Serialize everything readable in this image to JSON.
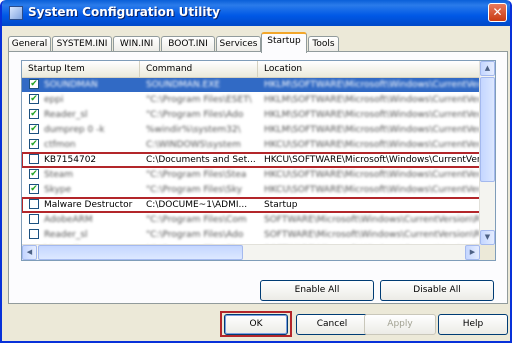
{
  "window": {
    "title": "System Configuration Utility",
    "close_glyph": "✕"
  },
  "tabs": [
    "General",
    "SYSTEM.INI",
    "WIN.INI",
    "BOOT.INI",
    "Services",
    "Startup",
    "Tools"
  ],
  "active_tab": "Startup",
  "columns": [
    "Startup Item",
    "Command",
    "Location"
  ],
  "rows": [
    {
      "item": "SOUNDMAN",
      "command": "SOUNDMAN.EXE",
      "location": "HKLM\\SOFTWARE\\Microsoft\\Windows\\CurrentVersion\\Run",
      "checked": true
    },
    {
      "item": "eppi",
      "command": "\"C:\\Program Files\\ESET\\",
      "location": "HKLM\\SOFTWARE\\Microsoft\\Windows\\CurrentVer",
      "checked": true
    },
    {
      "item": "Reader_sl",
      "command": "\"C:\\Program Files\\Ado",
      "location": "HKLM\\SOFTWARE\\Microsoft\\Windows\\CurrentVer",
      "checked": true
    },
    {
      "item": "dumprep 0 -k",
      "command": "%windir%\\system32\\",
      "location": "HKLM\\SOFTWARE\\Microsoft\\Windows\\CurrentVer",
      "checked": true
    },
    {
      "item": "ctfmon",
      "command": "C:\\WINDOWS\\system",
      "location": "HKCU\\SOFTWARE\\Microsoft\\Windows\\CurrentVer",
      "checked": true
    },
    {
      "item": "KB7154702",
      "command": "C:\\Documents and Set...",
      "location": "HKCU\\SOFTWARE\\Microsoft\\Windows\\CurrentVer...",
      "checked": false
    },
    {
      "item": "Steam",
      "command": "\"C:\\Program Files\\Stea",
      "location": "HKCU\\SOFTWARE\\Microsoft\\Windows\\CurrentVer",
      "checked": true
    },
    {
      "item": "Skype",
      "command": "\"C:\\Program Files\\Sky",
      "location": "HKCU\\SOFTWARE\\Microsoft\\Windows\\CurrentVer",
      "checked": true
    },
    {
      "item": "Malware Destructor",
      "command": "C:\\DOCUME~1\\ADMI...",
      "location": "Startup",
      "checked": false
    },
    {
      "item": "AdobeARM",
      "command": "\"C:\\Program Files\\Com",
      "location": "SOFTWARE\\Microsoft\\Windows\\CurrentVersion\\Run",
      "checked": false
    },
    {
      "item": "Reader_sl",
      "command": "\"C:\\Program Files\\Ado",
      "location": "SOFTWARE\\Microsoft\\Windows\\CurrentVersion\\Run",
      "checked": false
    },
    {
      "item": "bluesoil",
      "command": "\"C:\\Program Files\\Blu",
      "location": "SOFTWARE\\Microsoft\\Windows\\CurrentVersion\\Run",
      "checked": false
    }
  ],
  "buttons": {
    "enable_all": "Enable All",
    "disable_all": "Disable All",
    "ok": "OK",
    "cancel": "Cancel",
    "apply": "Apply",
    "help": "Help"
  },
  "scroll_glyphs": {
    "up": "▲",
    "down": "▼",
    "left": "◀",
    "right": "▶"
  },
  "colors": {
    "selected_row": "#316ac5",
    "highlight_box": "#b3262a",
    "title_bar": "#0058e6"
  }
}
